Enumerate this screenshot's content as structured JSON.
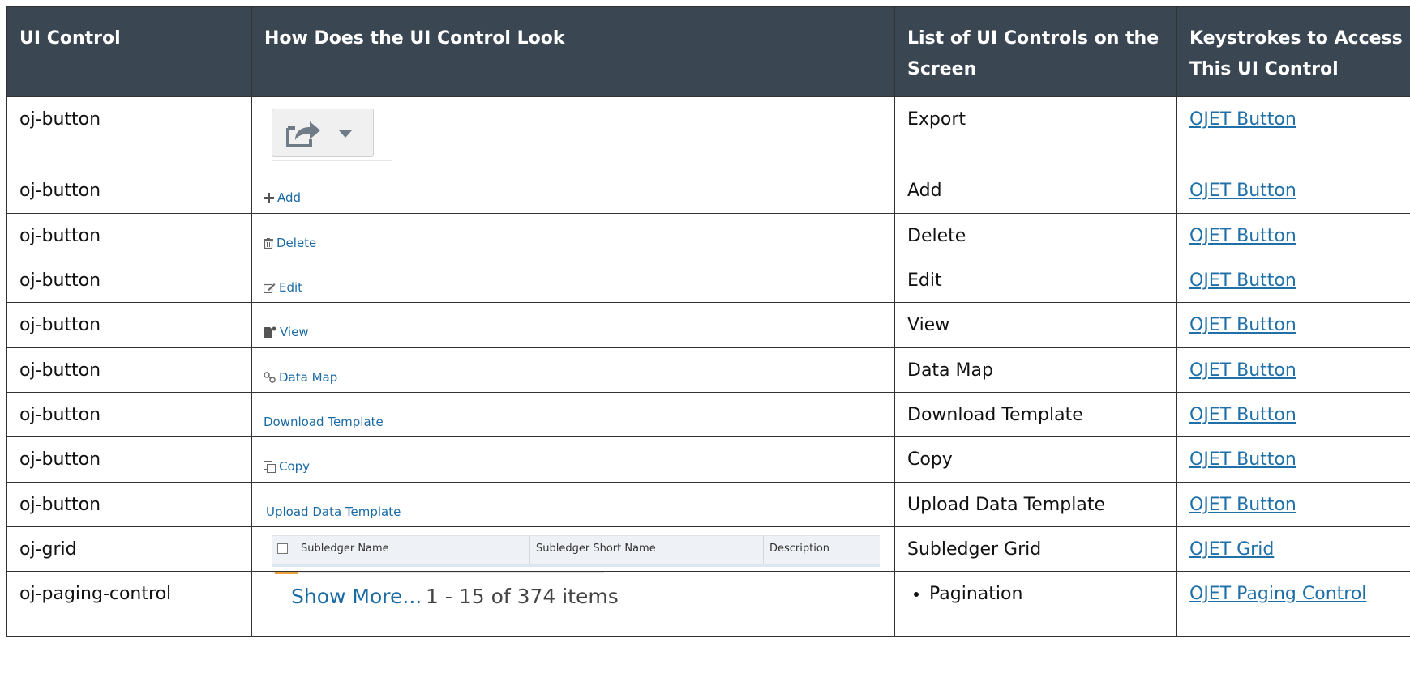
{
  "table": {
    "headers": {
      "control": "UI Control",
      "look": "How Does the UI Control Look",
      "list": "List of UI Controls on the Screen",
      "keys": "Keystrokes to Access This UI Control"
    },
    "rows": [
      {
        "control": "oj-button",
        "list": "Export",
        "keys": "OJET Button",
        "look_icon": "export-icon"
      },
      {
        "control": "oj-button",
        "look_label": "Add",
        "look_icon": "plus-icon",
        "list": "Add",
        "keys": "OJET Button"
      },
      {
        "control": "oj-button",
        "look_label": "Delete",
        "look_icon": "trash-icon",
        "list": "Delete",
        "keys": "OJET Button"
      },
      {
        "control": "oj-button",
        "look_label": "Edit",
        "look_icon": "edit-icon",
        "list": "Edit",
        "keys": "OJET Button"
      },
      {
        "control": "oj-button",
        "look_label": "View",
        "look_icon": "view-icon",
        "list": "View",
        "keys": "OJET Button"
      },
      {
        "control": "oj-button",
        "look_label": "Data Map",
        "look_icon": "link-icon",
        "list": "Data Map",
        "keys": "OJET Button"
      },
      {
        "control": "oj-button",
        "look_label": "Download Template",
        "list": "Download Template",
        "keys": "OJET Button"
      },
      {
        "control": "oj-button",
        "look_label": "Copy",
        "look_icon": "copy-icon",
        "list": "Copy",
        "keys": "OJET Button"
      },
      {
        "control": "oj-button",
        "look_label": "Upload Data Template",
        "list": "Upload Data Template",
        "keys": "OJET Button"
      },
      {
        "control": "oj-grid",
        "look_grid": {
          "col1": "Subledger Name",
          "col2": "Subledger Short Name",
          "col3": "Description"
        },
        "list": "Subledger Grid",
        "keys": "OJET Grid"
      },
      {
        "control": "oj-paging-control",
        "look_paging": {
          "more": "Show More...",
          "range": "1 - 15 of 374 items"
        },
        "list_bullets": [
          "Pagination"
        ],
        "keys": "OJET Paging Control"
      }
    ]
  },
  "colors": {
    "header_bg": "#3a4753",
    "link": "#1f6fa8",
    "ui_link": "#1a6aa5"
  }
}
